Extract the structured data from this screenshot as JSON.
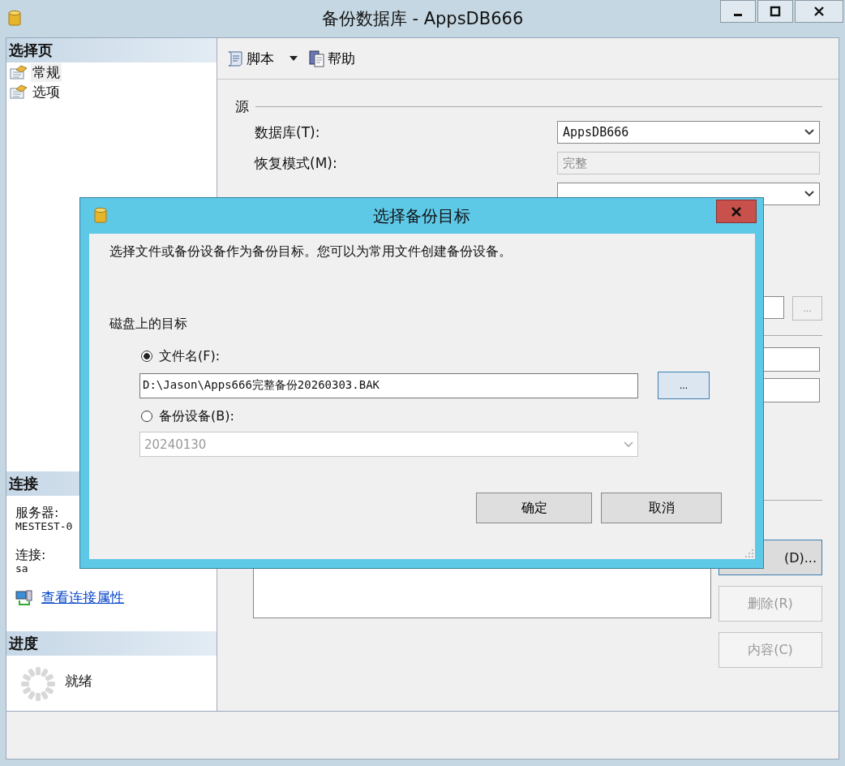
{
  "window": {
    "title": "备份数据库 - AppsDB666"
  },
  "sidebar": {
    "pages_header": "选择页",
    "pages": [
      {
        "label": "常规",
        "selected": true
      },
      {
        "label": "选项",
        "selected": false
      }
    ],
    "connection_header": "连接",
    "server_label": "服务器:",
    "server": "MESTEST-0",
    "connection_label": "连接:",
    "user": "sa",
    "link": "查看连接属性",
    "progress_header": "进度",
    "progress_status": "就绪"
  },
  "toolbar": {
    "script": "脚本",
    "help": "帮助"
  },
  "source": {
    "title": "源",
    "fields": [
      {
        "label": "数据库(T):",
        "value": "AppsDB666",
        "kind": "combo"
      },
      {
        "label": "恢复模式(M):",
        "value": "完整",
        "kind": "readonly"
      },
      {
        "kind": "combo"
      }
    ]
  },
  "destination": {
    "browse_button": "...",
    "buttons": [
      {
        "label": "(D)...",
        "disabled": false
      },
      {
        "label": "删除(R)",
        "disabled": true
      },
      {
        "label": "内容(C)",
        "disabled": true
      }
    ]
  },
  "dialog": {
    "title": "选择备份目标",
    "description": "选择文件或备份设备作为备份目标。您可以为常用文件创建备份设备。",
    "section": "磁盘上的目标",
    "options": [
      {
        "label": "文件名(F):",
        "selected": true,
        "kind": "text",
        "value": "D:\\Jason\\Apps666完整备份20260303.BAK"
      },
      {
        "label": "备份设备(B):",
        "selected": false,
        "kind": "combo",
        "value": "20240130"
      }
    ],
    "browse_button": "...",
    "buttons": [
      "确定",
      "取消"
    ]
  }
}
